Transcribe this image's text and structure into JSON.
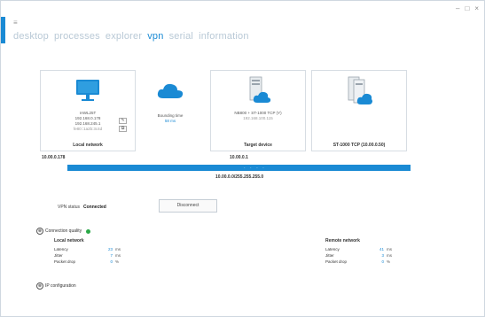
{
  "window": {
    "app_glyph": "≡",
    "controls": [
      "–",
      "□",
      "×"
    ]
  },
  "nav": {
    "items": [
      {
        "label": "desktop",
        "active": false
      },
      {
        "label": "processes",
        "active": false
      },
      {
        "label": "explorer",
        "active": false
      },
      {
        "label": "vpn",
        "active": true
      },
      {
        "label": "serial",
        "active": false
      },
      {
        "label": "information",
        "active": false
      }
    ]
  },
  "local": {
    "name": "IAWL25T",
    "lines": [
      "192.168.0.178",
      "192.168.245.1",
      "fe80::1a2b:3c4d"
    ],
    "title": "Local network",
    "ip": "10.00.0.178"
  },
  "routing": {
    "label": "Bounding time",
    "value": "58 ms"
  },
  "target": {
    "name": "NB800 + ST-1000 TCP (Y)",
    "line": "192.168.100.115",
    "title": "Target device",
    "ip": "10.00.0.1"
  },
  "remote": {
    "title": "ST-1000 TCP (10.00.0.50)"
  },
  "tunnel": {
    "dots": "· · · ·",
    "subnet": "10.00.0.0/255.255.255.0"
  },
  "status": {
    "label": "VPN status",
    "value": "Connected",
    "disconnect_label": "Disconnect"
  },
  "quality": {
    "label": "Connection quality",
    "toggle": "⊗",
    "color": "#2aa847"
  },
  "local_stats": {
    "title": "Local network",
    "rows": [
      {
        "label": "Latency",
        "value": "23",
        "unit": "ms"
      },
      {
        "label": "Jitter",
        "value": "7",
        "unit": "ms"
      },
      {
        "label": "Packet drop",
        "value": "0",
        "unit": "%"
      }
    ]
  },
  "remote_stats": {
    "title": "Remote network",
    "rows": [
      {
        "label": "Latency",
        "value": "41",
        "unit": "ms"
      },
      {
        "label": "Jitter",
        "value": "3",
        "unit": "ms"
      },
      {
        "label": "Packet drop",
        "value": "0",
        "unit": "%"
      }
    ]
  },
  "ip_config": {
    "label": "IP configuration",
    "toggle": "⊗"
  },
  "colors": {
    "accent": "#1a8ad4",
    "nav_inactive": "#b9c9d6",
    "ok": "#2aa847"
  },
  "icons": [
    "monitor-icon",
    "cloud-icon",
    "server-cloud-icon",
    "server-stack-cloud-icon"
  ]
}
